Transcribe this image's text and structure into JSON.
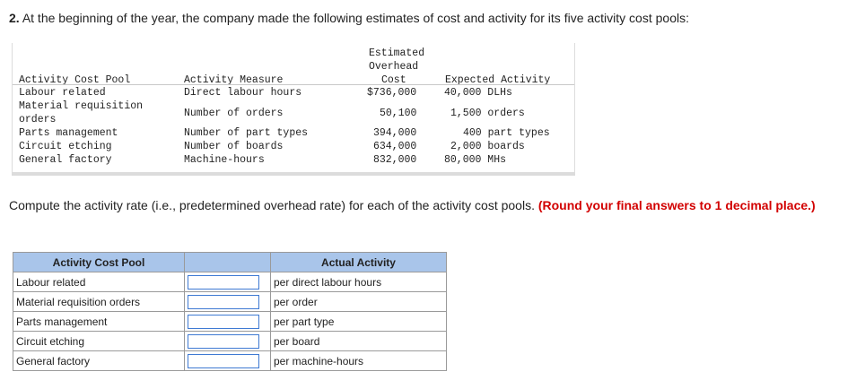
{
  "question": {
    "number": "2.",
    "text": "At the beginning of the year, the company made the following estimates of cost and activity for its five activity cost pools:"
  },
  "estimates": {
    "headers": {
      "pool": "Activity Cost Pool",
      "measure": "Activity Measure",
      "cost_line1": "Estimated",
      "cost_line2": "Overhead",
      "cost_line3": "Cost",
      "activity": "Expected Activity"
    },
    "rows": [
      {
        "pool": "Labour related",
        "pool2": "",
        "measure": "Direct labour hours",
        "cost": "$736,000",
        "activity": "40,000 DLHs"
      },
      {
        "pool": "Material requisition",
        "pool2": "orders",
        "measure": "Number of orders",
        "cost": "50,100",
        "activity": "1,500 orders"
      },
      {
        "pool": "Parts management",
        "pool2": "",
        "measure": "Number of part types",
        "cost": "394,000",
        "activity": "400 part types"
      },
      {
        "pool": "Circuit etching",
        "pool2": "",
        "measure": "Number of boards",
        "cost": "634,000",
        "activity": "2,000 boards"
      },
      {
        "pool": "General factory",
        "pool2": "",
        "measure": "Machine-hours",
        "cost": "832,000",
        "activity": "80,000 MHs"
      }
    ]
  },
  "instruction": {
    "text": "Compute the activity rate (i.e., predetermined overhead rate) for each of the activity cost pools.",
    "emphasis": "(Round your final answers to 1 decimal place.)"
  },
  "answer_table": {
    "headers": {
      "pool": "Activity Cost Pool",
      "blank": "",
      "actual": "Actual Activity"
    },
    "rows": [
      {
        "pool": "Labour related",
        "unit": "per direct labour hours",
        "value": ""
      },
      {
        "pool": "Material requisition orders",
        "unit": "per order",
        "value": ""
      },
      {
        "pool": "Parts management",
        "unit": "per part type",
        "value": ""
      },
      {
        "pool": "Circuit etching",
        "unit": "per board",
        "value": ""
      },
      {
        "pool": "General factory",
        "unit": "per machine-hours",
        "value": ""
      }
    ]
  }
}
